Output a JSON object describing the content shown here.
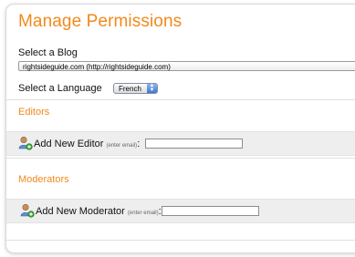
{
  "page": {
    "title": "Manage Permissions"
  },
  "blog": {
    "label": "Select a Blog",
    "selected": "rightsideguide.com (http://rightsideguide.com)"
  },
  "language": {
    "label": "Select a Language",
    "selected": "French"
  },
  "editors": {
    "title": "Editors",
    "add_label": "Add New Editor",
    "hint": "(enter email)",
    "colon": ":",
    "email_value": ""
  },
  "moderators": {
    "title": "Moderators",
    "add_label": "Add New Moderator",
    "hint": "(enter email)",
    "colon": ":",
    "email_value": ""
  },
  "colors": {
    "accent": "#f08a1c",
    "band": "#eeeeee"
  },
  "icons": {
    "add_user": "add-user-icon",
    "language_stepper": "updown-arrows-icon"
  }
}
